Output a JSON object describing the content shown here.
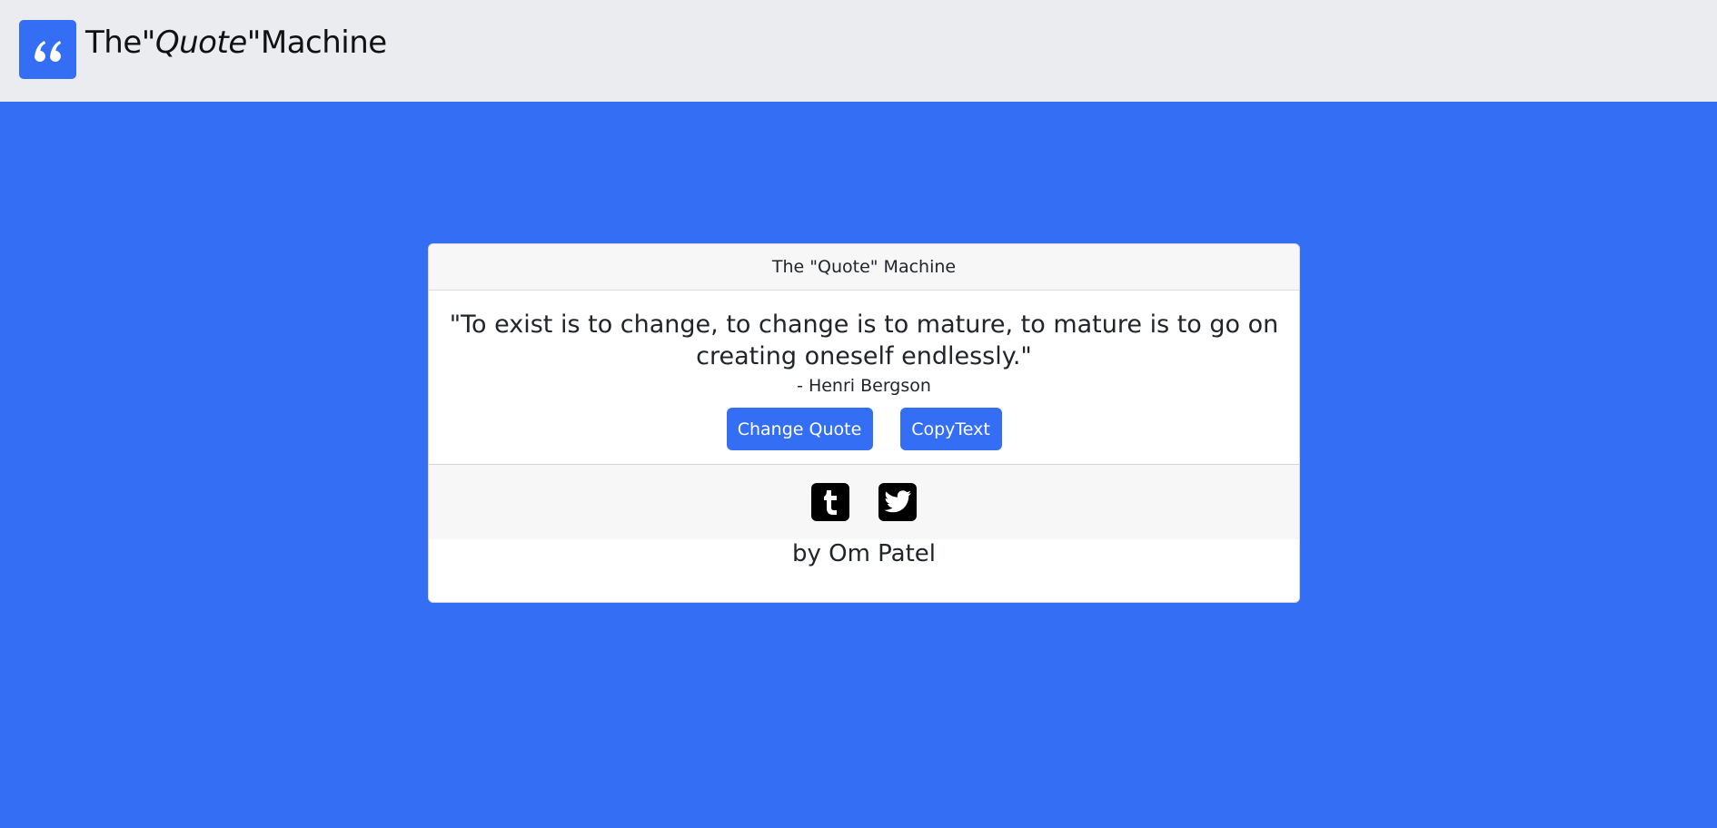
{
  "navbar": {
    "logo_icon": "quote-left-icon",
    "title_prefix": "The\"",
    "title_em": "Quote",
    "title_suffix": "\"Machine"
  },
  "card": {
    "header": "The \"Quote\" Machine",
    "quote": "\"To exist is to change, to change is to mature, to mature is to go on creating oneself endlessly.\"",
    "author": "- Henri Bergson",
    "buttons": {
      "change_label": "Change Quote",
      "copy_label": "CopyText"
    },
    "social": [
      {
        "icon": "tumblr-icon"
      },
      {
        "icon": "twitter-icon"
      }
    ],
    "credit": "by Om Patel"
  },
  "colors": {
    "background": "#346ef5",
    "navbar": "#eaecef",
    "accent": "#346ef5"
  }
}
